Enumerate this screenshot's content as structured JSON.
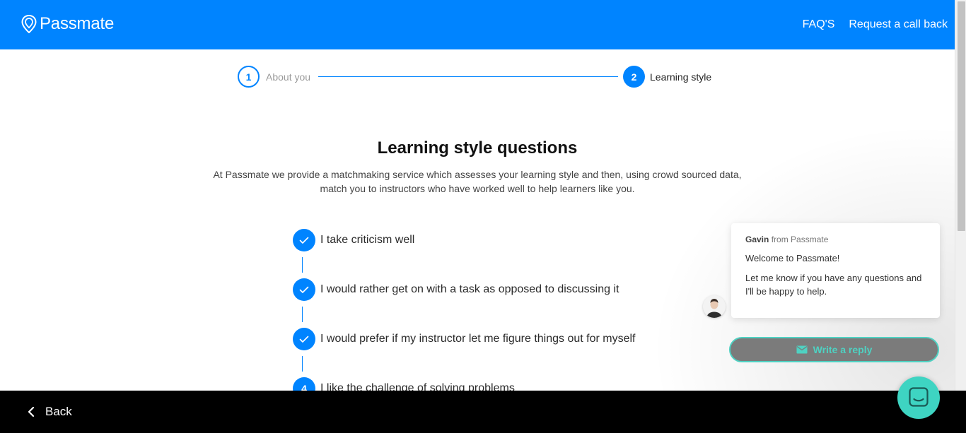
{
  "header": {
    "logo_text": "Passmate",
    "nav": {
      "faq": "FAQ'S",
      "callback": "Request a call back"
    }
  },
  "stepper": {
    "steps": [
      {
        "number": "1",
        "label": "About you"
      },
      {
        "number": "2",
        "label": "Learning style"
      }
    ]
  },
  "main": {
    "title": "Learning style questions",
    "subtitle_line1": "At Passmate we provide a matchmaking service which assesses your learning style and then, using crowd sourced data,",
    "subtitle_line2": "match you to instructors who have worked well to help learners like you.",
    "questions": [
      {
        "text": "I take criticism well",
        "state": "checked"
      },
      {
        "text": "I would rather get on with a task as opposed to discussing it",
        "state": "checked"
      },
      {
        "text": "I would prefer if my instructor let me figure things out for myself",
        "state": "checked"
      },
      {
        "number": "4",
        "text": "I like the challenge of solving problems",
        "state": "current"
      }
    ]
  },
  "chat": {
    "sender": "Gavin",
    "sender_suffix": "from Passmate",
    "message1": "Welcome to Passmate!",
    "message2": "Let me know if you have any questions and I'll be happy to help.",
    "reply_label": "Write a reply"
  },
  "footer": {
    "back_label": "Back"
  },
  "colors": {
    "brand": "#0084ff",
    "chat_accent": "#3ed4c2",
    "footer": "#000000"
  },
  "icons": {
    "logo": "location-pin-icon",
    "check": "check-icon",
    "back": "chevron-left-icon",
    "reply": "envelope-icon",
    "launcher": "chat-icon"
  }
}
